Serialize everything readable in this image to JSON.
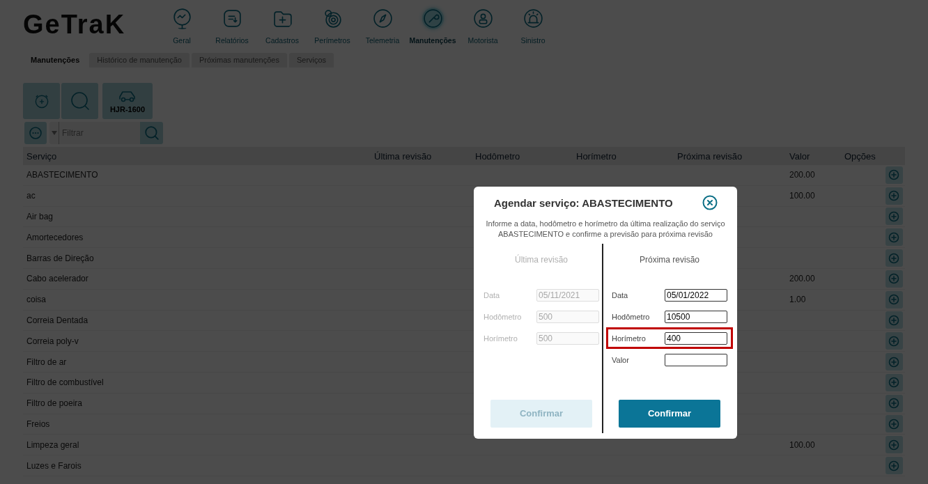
{
  "header": {
    "logo": "GeTraK",
    "nav": [
      {
        "label": "Geral",
        "selected": false
      },
      {
        "label": "Relatórios",
        "selected": false
      },
      {
        "label": "Cadastros",
        "selected": false
      },
      {
        "label": "Perímetros",
        "selected": false
      },
      {
        "label": "Telemetria",
        "selected": false
      },
      {
        "label": "Manutenções",
        "selected": true
      },
      {
        "label": "Motorista",
        "selected": false
      },
      {
        "label": "Sinistro",
        "selected": false
      }
    ]
  },
  "tabs": [
    {
      "label": "Manutenções",
      "selected": true
    },
    {
      "label": "Histórico de manutenção",
      "selected": false
    },
    {
      "label": "Próximas manutenções",
      "selected": false
    },
    {
      "label": "Serviços",
      "selected": false
    }
  ],
  "toolbar": {
    "vehicle_plate": "HJR-1600"
  },
  "filter": {
    "placeholder": "Filtrar"
  },
  "table": {
    "columns": [
      "Serviço",
      "Última revisão",
      "Hodômetro",
      "Horímetro",
      "Próxima revisão",
      "Valor",
      "Opções"
    ],
    "rows": [
      {
        "servico": "ABASTECIMENTO",
        "valor": "200.00"
      },
      {
        "servico": "ac",
        "valor": "100.00"
      },
      {
        "servico": "Air bag"
      },
      {
        "servico": "Amortecedores"
      },
      {
        "servico": "Barras de Direção"
      },
      {
        "servico": "Cabo acelerador",
        "valor": "200.00"
      },
      {
        "servico": "coisa",
        "valor": "1.00"
      },
      {
        "servico": "Correia Dentada"
      },
      {
        "servico": "Correia poly-v"
      },
      {
        "servico": "Filtro de ar"
      },
      {
        "servico": "Filtro de combustível"
      },
      {
        "servico": "Filtro de poeira"
      },
      {
        "servico": "Freios"
      },
      {
        "servico": "Limpeza geral",
        "valor": "100.00"
      },
      {
        "servico": "Luzes e Farois"
      }
    ]
  },
  "dialog": {
    "title": "Agendar serviço: ABASTECIMENTO",
    "description": "Informe a data, hodômetro e horímetro da última realização do serviço ABASTECIMENTO e confirme a previsão para próxima revisão",
    "sections": [
      {
        "heading": "Última revisão",
        "disabled": true,
        "button": "Confirmar",
        "fields": [
          {
            "label": "Data",
            "value": "05/11/2021",
            "highlighted": false
          },
          {
            "label": "Hodômetro",
            "value": "500",
            "highlighted": false
          },
          {
            "label": "Horímetro",
            "value": "500",
            "highlighted": false
          }
        ]
      },
      {
        "heading": "Próxima revisão",
        "disabled": false,
        "button": "Confirmar",
        "fields": [
          {
            "label": "Data",
            "value": "05/01/2022",
            "highlighted": false
          },
          {
            "label": "Hodômetro",
            "value": "10500",
            "highlighted": false
          },
          {
            "label": "Horímetro",
            "value": "400",
            "highlighted": true
          },
          {
            "label": "Valor",
            "highlighted": false
          }
        ]
      }
    ]
  }
}
